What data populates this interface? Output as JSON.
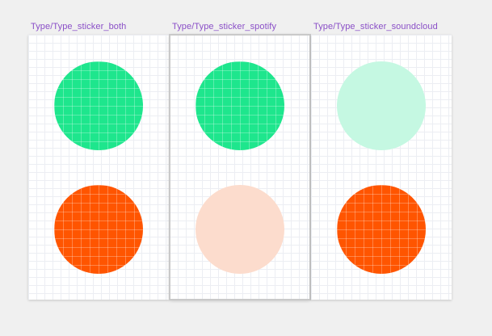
{
  "canvas": {
    "background": "#f0f0f0",
    "label_color": "#8a4fc7"
  },
  "frames": [
    {
      "label": "Type/Type_sticker_both",
      "selected": false,
      "stickers": [
        {
          "brand": "spotify",
          "state": "active",
          "color": "#1ee68d"
        },
        {
          "brand": "soundcloud",
          "state": "active",
          "color": "#ff5500"
        }
      ]
    },
    {
      "label": "Type/Type_sticker_spotify",
      "selected": true,
      "stickers": [
        {
          "brand": "spotify",
          "state": "active",
          "color": "#1ee68d"
        },
        {
          "brand": "soundcloud",
          "state": "inactive",
          "color": "#fcdccd"
        }
      ]
    },
    {
      "label": "Type/Type_sticker_soundcloud",
      "selected": false,
      "stickers": [
        {
          "brand": "spotify",
          "state": "inactive",
          "color": "#c5f8e2"
        },
        {
          "brand": "soundcloud",
          "state": "active",
          "color": "#ff5500"
        }
      ]
    }
  ]
}
